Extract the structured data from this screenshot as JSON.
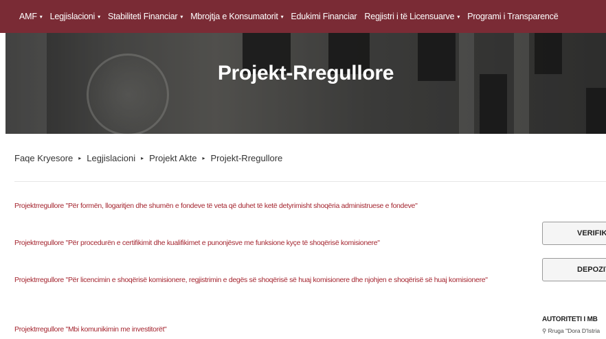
{
  "nav": {
    "items": [
      {
        "label": "AMF",
        "caret": true
      },
      {
        "label": "Legjislacioni",
        "caret": true
      },
      {
        "label": "Stabiliteti Financiar",
        "caret": true
      },
      {
        "label": "Mbrojtja e Konsumatorit",
        "caret": true
      },
      {
        "label": "Edukimi Financiar",
        "caret": false
      },
      {
        "label": "Regjistri i të Licensuarve",
        "caret": true
      },
      {
        "label": "Programi i Transparencë",
        "caret": false
      }
    ],
    "caret_glyph": "▾"
  },
  "hero": {
    "title": "Projekt-Rregullore"
  },
  "breadcrumb": {
    "items": [
      "Faqe Kryesore",
      "Legjislacioni",
      "Projekt Akte",
      "Projekt-Rregullore"
    ],
    "sep": "▸"
  },
  "documents": [
    "Projektrregullore \"Për formën, llogaritjen dhe shumën e fondeve të veta që duhet të ketë detyrimisht shoqëria administruese e fondeve\"",
    "Projektrregullore \"Për procedurën e certifikimit dhe kualifikimet e punonjësve me funksione kyçe të shoqërisë komisionere\"",
    "Projektrregullore \"Për licencimin e shoqërisë komisionere, regjistrimin e degës së shoqërisë së huaj komisionere dhe njohjen e shoqërisë së huaj komisionere\"",
    "Projektrregullore \"Mbi komunikimin me investitorët\""
  ],
  "sidebar": {
    "verify_label": "VERIFIKO",
    "deposit_label": "DEPOZITO",
    "org_title": "AUTORITETI I MB",
    "address": "Rruga \"Dora D'Istria",
    "pin_glyph": "⚲"
  },
  "colors": {
    "nav_bg": "#7a2b35",
    "link": "#a4252f"
  }
}
